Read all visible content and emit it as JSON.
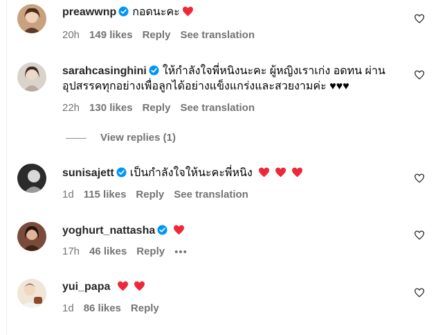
{
  "comments": [
    {
      "username": "preawwnp",
      "verified": true,
      "text": "กอดนะคะ",
      "hearts": 1,
      "time": "20h",
      "likes": "149 likes",
      "reply": "Reply",
      "translation": "See translation"
    },
    {
      "username": "sarahcasinghini",
      "verified": true,
      "text_line1": "ให้กำลังใจพี่หนิงนะคะ ผู้หญิงเราเก่ง อดทน ผ่าน",
      "text_line2": "อุปสรรคทุกอย่างเพื่อลูกได้อย่างแข็งแกร่งและสวยงามค่ะ ♥♥♥",
      "time": "22h",
      "likes": "130 likes",
      "reply": "Reply",
      "translation": "See translation"
    },
    {
      "username": "sunisajett",
      "verified": true,
      "text": "เป็นกำลังใจให้นะคะพี่หนิง",
      "hearts": 3,
      "time": "1d",
      "likes": "115 likes",
      "reply": "Reply",
      "translation": "See translation"
    },
    {
      "username": "yoghurt_nattasha",
      "verified": true,
      "hearts": 1,
      "time": "17h",
      "likes": "46 likes",
      "reply": "Reply",
      "more": "•••"
    },
    {
      "username": "yui_papa",
      "verified": false,
      "hearts": 2,
      "time": "1d",
      "likes": "86 likes",
      "reply": "Reply"
    }
  ],
  "view_replies": "View replies (1)",
  "colors": {
    "verified": "#0095f6",
    "heart": "#ed2939",
    "meta": "#737373"
  }
}
